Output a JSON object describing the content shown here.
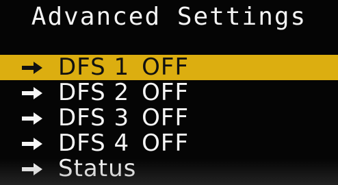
{
  "screen": {
    "title": "Advanced Settings"
  },
  "menu": {
    "items": [
      {
        "label": "DFS 1",
        "value": "OFF",
        "selected": true,
        "icon": "arrow-right-icon"
      },
      {
        "label": "DFS 2",
        "value": "OFF",
        "selected": false,
        "icon": "arrow-right-icon"
      },
      {
        "label": "DFS 3",
        "value": "OFF",
        "selected": false,
        "icon": "arrow-right-icon"
      },
      {
        "label": "DFS 4",
        "value": "OFF",
        "selected": false,
        "icon": "arrow-right-icon"
      },
      {
        "label": "Status",
        "value": "",
        "selected": false,
        "icon": "arrow-right-icon"
      }
    ]
  },
  "colors": {
    "background": "#050505",
    "text": "#f6f6f6",
    "selection": "#dcae10",
    "selected_text": "#111111"
  }
}
